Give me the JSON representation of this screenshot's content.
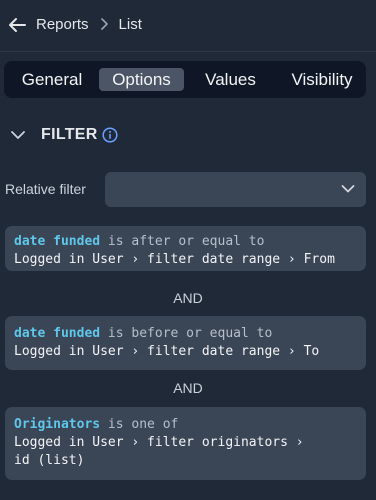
{
  "header": {
    "breadcrumbs": [
      "Reports",
      "List"
    ],
    "back_icon": "arrow-left-icon",
    "separator_icon": "chevron-right-icon"
  },
  "tabs": [
    {
      "label": "General",
      "active": false
    },
    {
      "label": "Options",
      "active": true
    },
    {
      "label": "Values",
      "active": false
    },
    {
      "label": "Visibility",
      "active": false
    }
  ],
  "section": {
    "title": "FILTER",
    "collapse_icon": "chevron-down-icon",
    "info_icon": "info-icon"
  },
  "relative_filter": {
    "label": "Relative filter",
    "value": "",
    "dropdown_icon": "chevron-down-icon"
  },
  "conditions": [
    {
      "field": "date funded",
      "operator": " is after or equal to",
      "value_lines": [
        "Logged in User › filter date range › From"
      ]
    },
    {
      "field": "date funded",
      "operator": " is before or equal to",
      "value_lines": [
        "Logged in User › filter date range › To"
      ]
    },
    {
      "field": "Originators",
      "operator": " is one of",
      "value_lines": [
        "Logged in User › filter originators ›",
        "id (list)"
      ]
    }
  ],
  "joiners": [
    "AND",
    "AND"
  ],
  "colors": {
    "background": "#1f2937",
    "card": "#3a4556",
    "tabbar": "#0f1726",
    "active_tab": "#4b5565",
    "field_accent": "#5fc7ea",
    "info_accent": "#6aa0ff"
  }
}
